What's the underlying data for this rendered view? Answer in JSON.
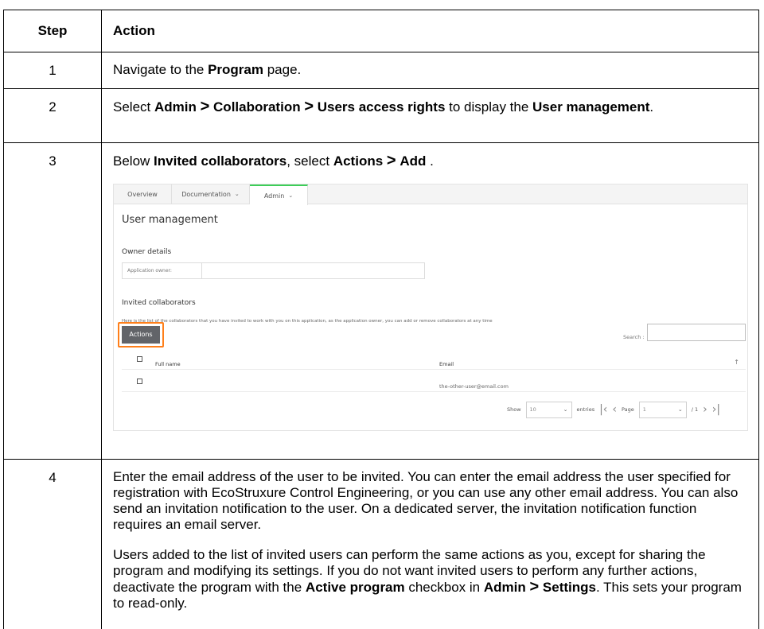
{
  "header": {
    "step": "Step",
    "action": "Action"
  },
  "steps": [
    {
      "num": "1",
      "pre": "Navigate to the ",
      "b1": "Program",
      "post": " page."
    },
    {
      "num": "2",
      "pre": "Select ",
      "b1": "Admin",
      "sep1": ">",
      "b2": "Collaboration",
      "sep2": ">",
      "b3": "Users access rights",
      "mid": " to display the ",
      "b4": "User management",
      "post": "."
    },
    {
      "num": "3",
      "pre": "Below ",
      "b1": "Invited collaborators",
      "mid": ", select ",
      "b2": "Actions",
      "sep1": ">",
      "b3": "Add",
      "post": " ."
    },
    {
      "num": "4",
      "p1": "Enter the email address of the user to be invited. You can enter the email address the user specified for registration with EcoStruxure Control Engineering, or you can use any other email address. You can also send an invitation notification to the user. On a dedicated server, the invitation notification function requires an email server.",
      "p2_pre": "Users added to the list of invited users can perform the same actions as you, except for sharing the program and modifying its settings. If you do not want invited users to perform any further actions, deactivate the program with the ",
      "p2_b1": "Active program",
      "p2_mid": " checkbox in ",
      "p2_b2": "Admin",
      "p2_sep": ">",
      "p2_b3": "Settings",
      "p2_post": ". This sets your program to read-only."
    }
  ],
  "screenshot": {
    "tabs": {
      "overview": "Overview",
      "documentation": "Documentation",
      "admin": "Admin"
    },
    "title": "User management",
    "owner_section": "Owner details",
    "owner_label": "Application owner:",
    "invited_section": "Invited collaborators",
    "invited_desc": "Here is the list of the collaborators that you have invited to work with you on this application, as the application owner, you can add or remove collaborators at any time",
    "actions_button": "Actions",
    "search_label": "Search :",
    "columns": {
      "full_name": "Full name",
      "email": "Email"
    },
    "rows": [
      {
        "full_name": "",
        "email": "the-other-user@email.com"
      }
    ],
    "pager": {
      "show": "Show",
      "entries_value": "10",
      "entries": "entries",
      "page": "Page",
      "page_value": "1",
      "total": "/ 1"
    },
    "highlight_color": "#ff7f1a",
    "active_tab_color": "#3dcd58"
  }
}
